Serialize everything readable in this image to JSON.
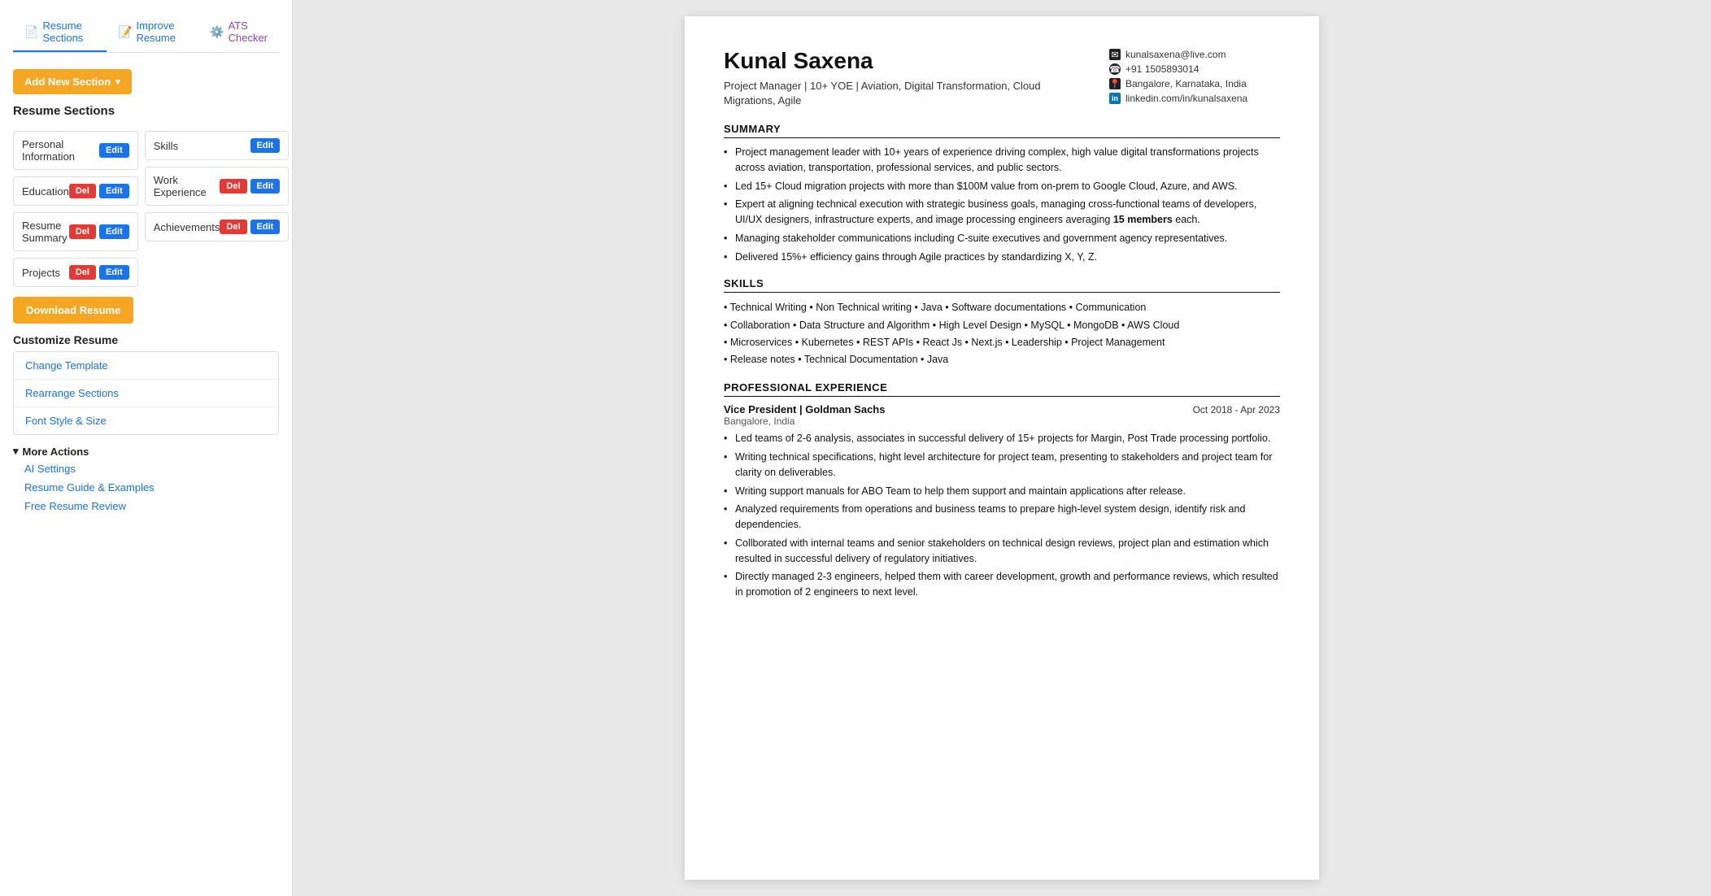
{
  "tabs": [
    {
      "id": "resume-sections",
      "label": "Resume Sections",
      "icon": "📄",
      "active": true
    },
    {
      "id": "improve-resume",
      "label": "Improve Resume",
      "icon": "📝",
      "active": false
    },
    {
      "id": "ats-checker",
      "label": "ATS Checker",
      "icon": "⚙️",
      "active": false
    }
  ],
  "add_section_button": "Add New Section",
  "sections_heading": "Resume Sections",
  "left_sections": [
    {
      "label": "Personal Information",
      "has_del": false,
      "has_edit": true
    },
    {
      "label": "Education",
      "has_del": true,
      "has_edit": true
    },
    {
      "label": "Resume Summary",
      "has_del": true,
      "has_edit": true
    },
    {
      "label": "Projects",
      "has_del": true,
      "has_edit": true
    }
  ],
  "right_sections": [
    {
      "label": "Skills",
      "has_del": false,
      "has_edit": true
    },
    {
      "label": "Work Experience",
      "has_del": true,
      "has_edit": true
    },
    {
      "label": "Achievements",
      "has_del": true,
      "has_edit": true
    }
  ],
  "del_label": "Del",
  "edit_label": "Edit",
  "download_button": "Download Resume",
  "customize_heading": "Customize Resume",
  "customize_items": [
    "Change Template",
    "Rearrange Sections",
    "Font Style & Size"
  ],
  "more_actions": {
    "label": "More Actions",
    "links": [
      "AI Settings",
      "Resume Guide & Examples",
      "Free Resume Review"
    ]
  },
  "resume": {
    "name": "Kunal Saxena",
    "title": "Project Manager | 10+ YOE | Aviation, Digital Transformation, Cloud Migrations, Agile",
    "contact": [
      {
        "icon": "✉",
        "type": "email",
        "value": "kunalsaxena@live.com"
      },
      {
        "icon": "☎",
        "type": "phone",
        "value": "+91 1505893014"
      },
      {
        "icon": "📍",
        "type": "location",
        "value": "Bangalore, Karnataka, India"
      },
      {
        "icon": "in",
        "type": "linkedin",
        "value": "linkedin.com/in/kunalsaxena"
      }
    ],
    "sections": {
      "summary": {
        "title": "SUMMARY",
        "bullets": [
          "Project management leader with 10+ years of experience driving complex, high value digital transformations projects across aviation, transportation, professional services, and public sectors.",
          "Led 15+ Cloud migration projects with more than $100M value from on-prem to Google Cloud, Azure, and AWS.",
          "Expert at aligning technical execution with strategic business goals, managing cross-functional teams of developers, UI/UX designers, infrastructure experts, and image processing engineers averaging 15 members each.",
          "Managing stakeholder communications including C-suite executives and government agency representatives.",
          "Delivered 15%+ efficiency gains through Agile practices by standardizing X, Y, Z."
        ]
      },
      "skills": {
        "title": "SKILLS",
        "lines": [
          "• Technical Writing  • Non Technical writing  • Java  • Software documentations  • Communication",
          "• Collaboration  • Data Structure and Algorithm  • High Level Design  • MySQL  • MongoDB  • AWS Cloud",
          "• Microservices  • Kubernetes  • REST APIs  • React Js  • Next.js  • Leadership  • Project Management",
          "• Release notes  • Technical Documentation  • Java"
        ]
      },
      "experience": {
        "title": "PROFESSIONAL EXPERIENCE",
        "jobs": [
          {
            "title": "Vice President | Goldman Sachs",
            "location": "Bangalore, India",
            "dates": "Oct 2018 - Apr 2023",
            "bullets": [
              "Led teams of 2-6 analysis, associates in successful delivery of 15+ projects for Margin, Post Trade processing portfolio.",
              "Writing technical specifications, hight level architecture for project team, presenting to stakeholders and project team for clarity on deliverables.",
              "Writing support manuals for ABO Team to help them support and maintain applications after release.",
              "Analyzed requirements from operations and business teams to prepare high-level system design, identify risk and dependencies.",
              "Collborated with internal teams and senior stakeholders on technical design reviews, project plan and estimation which resulted in successful delivery of regulatory initiatives.",
              "Directly managed 2-3 engineers, helped them with career development, growth and performance reviews, which resulted in promotion of 2 engineers to next level."
            ]
          }
        ]
      }
    }
  }
}
